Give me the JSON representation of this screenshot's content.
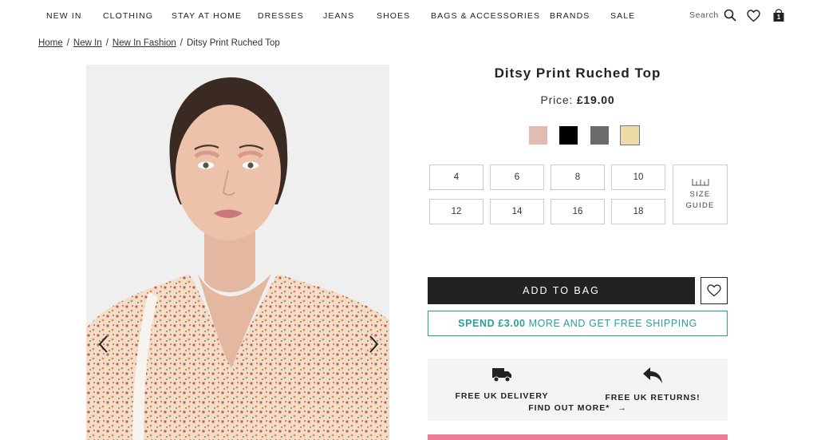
{
  "nav": {
    "items": [
      "NEW IN",
      "CLOTHING",
      "STAY AT HOME",
      "DRESSES",
      "JEANS",
      "SHOES",
      "BAGS & ACCESSORIES",
      "BRANDS",
      "SALE"
    ],
    "search_label": "Search",
    "icons": [
      "search-icon",
      "heart-icon",
      "bag-icon"
    ],
    "bag_count": "1"
  },
  "breadcrumb": {
    "items": [
      "Home",
      "New In",
      "New In Fashion"
    ],
    "current": "Ditsy Print Ruched Top",
    "separator": "/"
  },
  "product": {
    "title": "Ditsy Print Ruched Top",
    "price_label": "Price:",
    "price_value": "£19.00",
    "colors": [
      "#e2bcb3",
      "#000000",
      "#6b6b6b",
      "#eedca8"
    ],
    "selected_color_index": 3,
    "sizes": [
      "4",
      "6",
      "8",
      "10",
      "12",
      "14",
      "16",
      "18"
    ],
    "size_guide_line1": "SIZE",
    "size_guide_line2": "GUIDE"
  },
  "actions": {
    "add_to_bag": "ADD TO BAG"
  },
  "shipping_banner": {
    "strong": "SPEND £3.00",
    "rest": "MORE AND GET FREE SHIPPING",
    "color": "#2a9d9a"
  },
  "delivery": {
    "delivery_label": "FREE UK DELIVERY",
    "returns_label": "FREE UK RETURNS!",
    "find_out": "FIND OUT MORE*",
    "arrow": "→"
  },
  "accent_colors": {
    "dark": "#222222",
    "teal": "#2a9d9a",
    "pink": "#f27a9b"
  }
}
